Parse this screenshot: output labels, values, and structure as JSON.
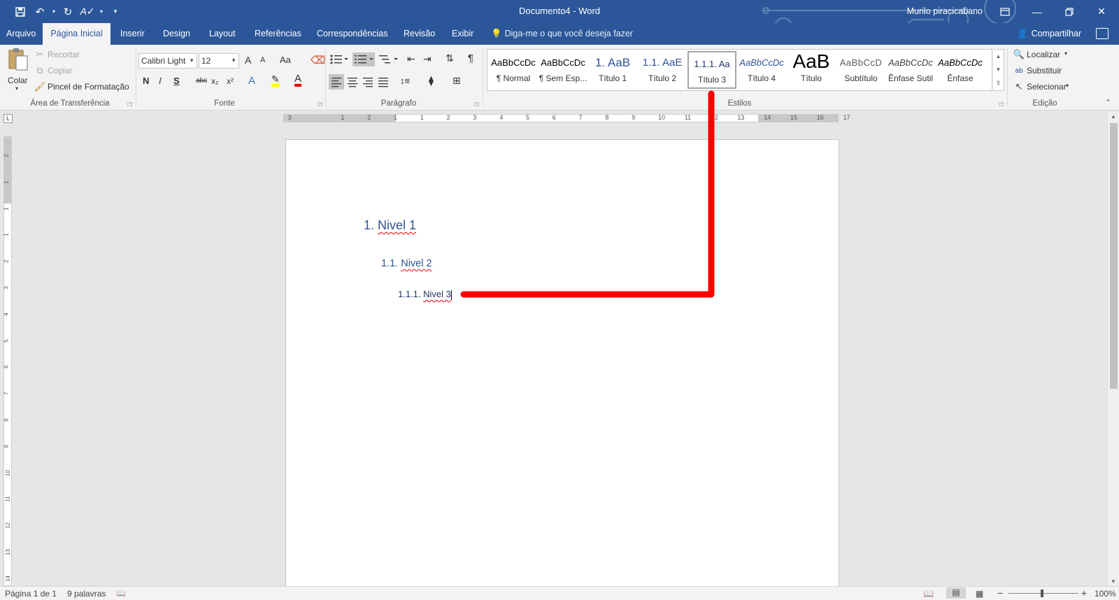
{
  "titlebar": {
    "title": "Documento4  -  Word",
    "user": "Murilo piracicabano"
  },
  "tabs": [
    {
      "label": "Arquivo"
    },
    {
      "label": "Página Inicial"
    },
    {
      "label": "Inserir"
    },
    {
      "label": "Design"
    },
    {
      "label": "Layout"
    },
    {
      "label": "Referências"
    },
    {
      "label": "Correspondências"
    },
    {
      "label": "Revisão"
    },
    {
      "label": "Exibir"
    }
  ],
  "tell_me": "Diga-me o que você deseja fazer",
  "share": "Compartilhar",
  "clipboard": {
    "paste": "Colar",
    "cut": "Recortar",
    "copy": "Copiar",
    "format_painter": "Pincel de Formatação",
    "label": "Área de Transferência"
  },
  "font": {
    "name": "Calibri Light",
    "size": "12",
    "label": "Fonte",
    "bold": "N",
    "italic": "I",
    "underline": "S",
    "strike": "abc",
    "subscript": "x₂",
    "superscript": "x²",
    "grow": "A",
    "shrink": "A",
    "change_case": "Aa"
  },
  "paragraph": {
    "label": "Parágrafo"
  },
  "styles": {
    "label": "Estilos",
    "items": [
      {
        "preview": "AaBbCcDc",
        "name": "¶ Normal"
      },
      {
        "preview": "AaBbCcDc",
        "name": "¶ Sem Esp..."
      },
      {
        "preview": "1.  AaB",
        "name": "Título 1"
      },
      {
        "preview": "1.1.  AaE",
        "name": "Título 2"
      },
      {
        "preview": "1.1.1.  Aa",
        "name": "Título 3"
      },
      {
        "preview": "AaBbCcDc",
        "name": "Título 4"
      },
      {
        "preview": "AaB",
        "name": "Título"
      },
      {
        "preview": "AaBbCcD",
        "name": "Subtítulo"
      },
      {
        "preview": "AaBbCcDc",
        "name": "Ênfase Sutil"
      },
      {
        "preview": "AaBbCcDc",
        "name": "Ênfase"
      }
    ]
  },
  "editing": {
    "find": "Localizar",
    "replace": "Substituir",
    "select": "Selecionar",
    "label": "Edição"
  },
  "ruler": {
    "top_numbers": [
      "3",
      "1",
      "2",
      "1",
      "1",
      "2",
      "3",
      "4",
      "5",
      "6",
      "7",
      "8",
      "9",
      "10",
      "11",
      "12",
      "13",
      "14",
      "15",
      "16",
      "17"
    ],
    "side_numbers": [
      "2",
      "1",
      "1",
      "1",
      "2",
      "3",
      "4",
      "5",
      "6",
      "7",
      "8",
      "9",
      "10",
      "11",
      "12",
      "13",
      "14"
    ]
  },
  "document": {
    "level1_number": "1.",
    "level1_text": "Nivel 1",
    "level2_number": "1.1.",
    "level2_text": "Nivel 2",
    "level3_number": "1.1.1.",
    "level3_text": "Nivel 3"
  },
  "statusbar": {
    "page": "Página 1 de 1",
    "words": "9 palavras",
    "zoom": "100%"
  },
  "colors": {
    "title_bar": "#2b579a",
    "heading": "#2f5496",
    "annotation": "#ff0000"
  }
}
